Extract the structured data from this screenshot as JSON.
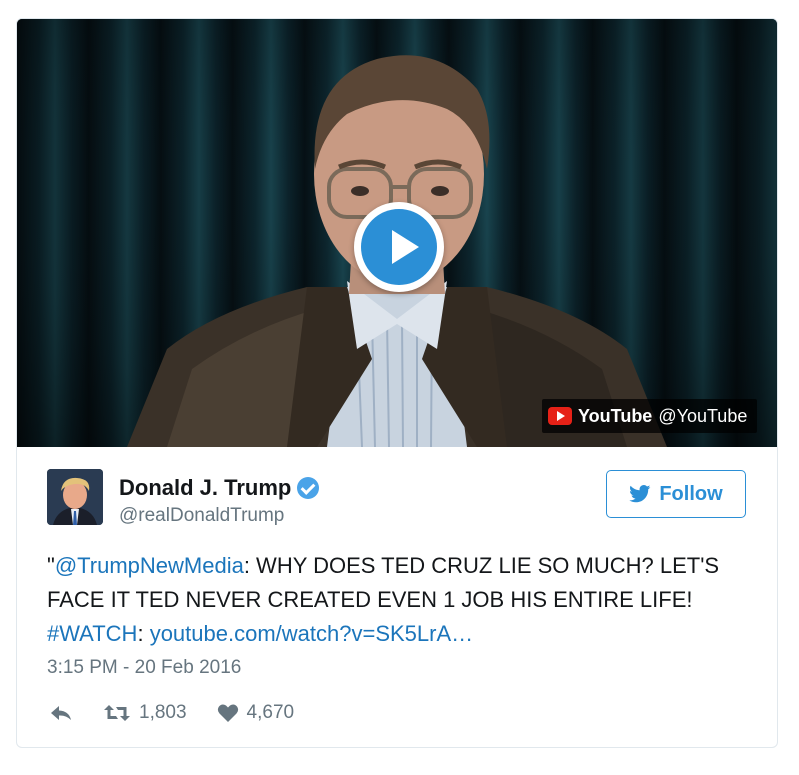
{
  "media": {
    "badge_brand": "YouTube",
    "badge_handle": "@YouTube",
    "play_icon": "play-icon",
    "accent": "#2b8fd6"
  },
  "author": {
    "display_name": "Donald J. Trump",
    "handle": "@realDonaldTrump",
    "verified_icon": "verified-badge-icon"
  },
  "follow": {
    "label": "Follow",
    "icon": "twitter-bird-icon"
  },
  "tweet": {
    "quote_open": "\"",
    "mention": "@TrumpNewMedia",
    "text_part1": ": WHY DOES TED CRUZ LIE SO MUCH? LET'S FACE IT TED NEVER CREATED EVEN 1 JOB HIS ENTIRE LIFE! ",
    "hashtag": "#WATCH",
    "text_part2": ": ",
    "link": "youtube.com/watch?v=SK5LrA…"
  },
  "timestamp": "3:15 PM - 20 Feb 2016",
  "actions": {
    "reply_icon": "reply-icon",
    "retweet_icon": "retweet-icon",
    "retweet_count": "1,803",
    "like_icon": "heart-icon",
    "like_count": "4,670"
  },
  "colors": {
    "link": "#1b75bb",
    "muted": "#66757f",
    "youtube_red": "#e62117"
  }
}
